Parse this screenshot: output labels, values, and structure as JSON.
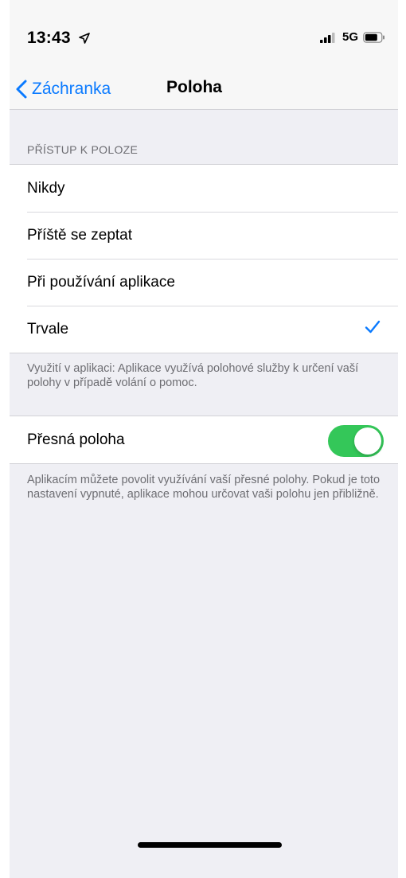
{
  "status_bar": {
    "time": "13:43",
    "network": "5G",
    "location_icon": "location-arrow-icon",
    "signal_icon": "signal-bars-icon",
    "battery_icon": "battery-icon"
  },
  "nav": {
    "back_label": "Záchranka",
    "title": "Poloha",
    "back_icon": "chevron-left-icon"
  },
  "location_access": {
    "header": "PŘÍSTUP K POLOZE",
    "options": [
      {
        "label": "Nikdy",
        "selected": false
      },
      {
        "label": "Příště se zeptat",
        "selected": false
      },
      {
        "label": "Při používání aplikace",
        "selected": false
      },
      {
        "label": "Trvale",
        "selected": true
      }
    ],
    "footer": "Využití v aplikaci: Aplikace využívá polohové služby k určení vaší polohy v případě volání o pomoc."
  },
  "precise_location": {
    "label": "Přesná poloha",
    "enabled": true,
    "footer": "Aplikacím můžete povolit využívání vaší přesné polohy. Pokud je toto nastavení vypnuté, aplikace mohou určovat vaši polohu jen přibližně."
  },
  "colors": {
    "accent": "#0a7aff",
    "toggle_on": "#34c759",
    "background": "#efeff4"
  }
}
